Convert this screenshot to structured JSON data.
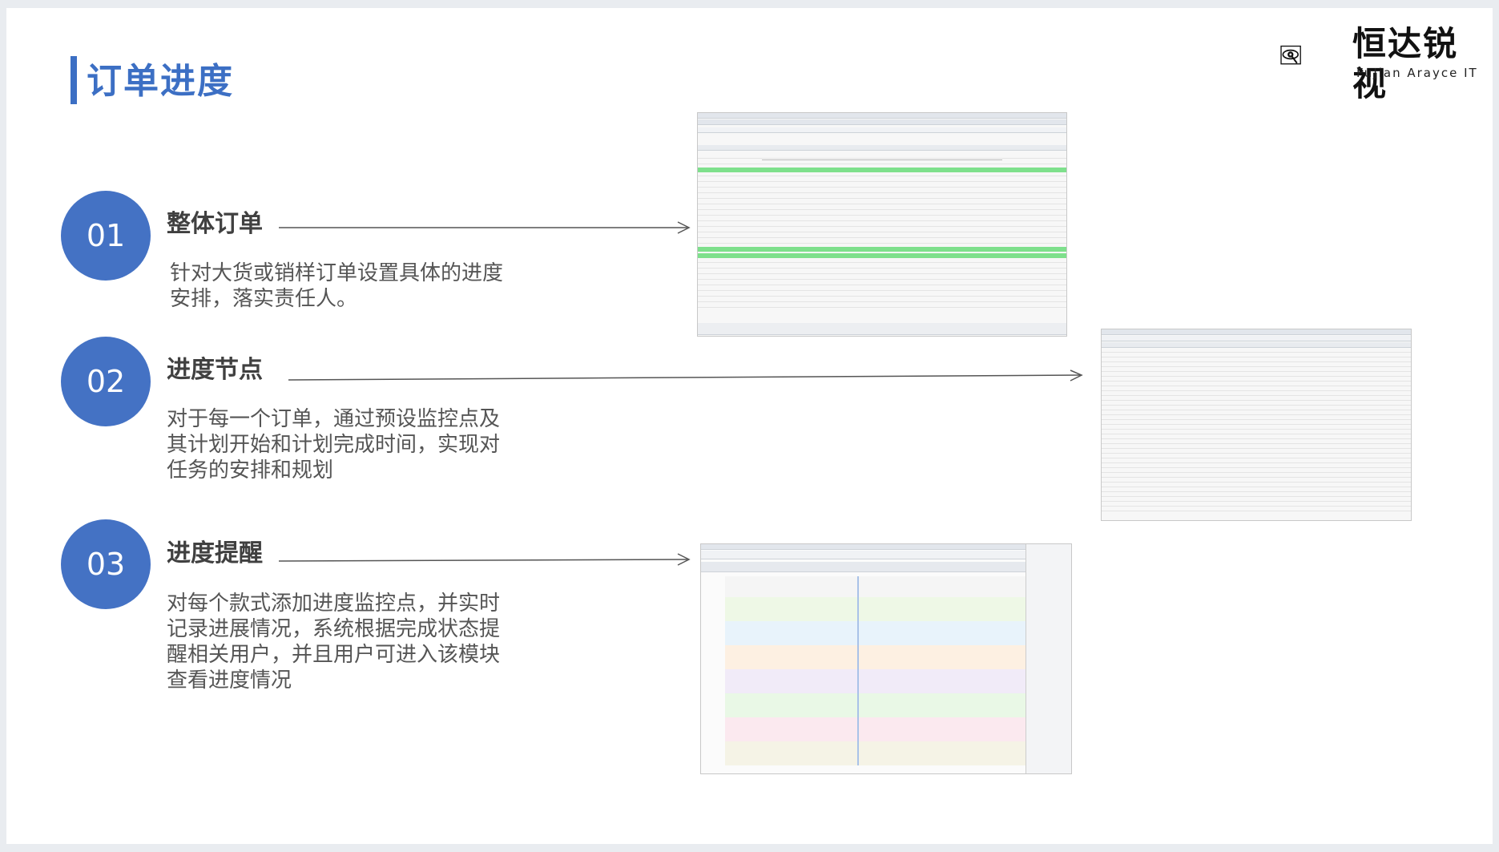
{
  "title": "订单进度",
  "logo": {
    "name": "恒达锐视",
    "subtitle": "FuJian Arayce IT",
    "icon": "eye-logo-icon"
  },
  "sections": [
    {
      "number": "01",
      "heading": "整体订单",
      "description": "针对大货或销样订单设置具体的进度安排，落实责任人。"
    },
    {
      "number": "02",
      "heading": "进度节点",
      "description": "对于每一个订单，通过预设监控点及其计划开始和计划完成时间，实现对任务的安排和规划"
    },
    {
      "number": "03",
      "heading": "进度提醒",
      "description": "对每个款式添加进度监控点，并实时记录进展情况，系统根据完成状态提醒相关用户，并且用户可进入该模块查看进度情况"
    }
  ],
  "colors": {
    "accent": "#4472c4",
    "title": "#3c6fc4",
    "highlight_row": "#7ee08c"
  }
}
